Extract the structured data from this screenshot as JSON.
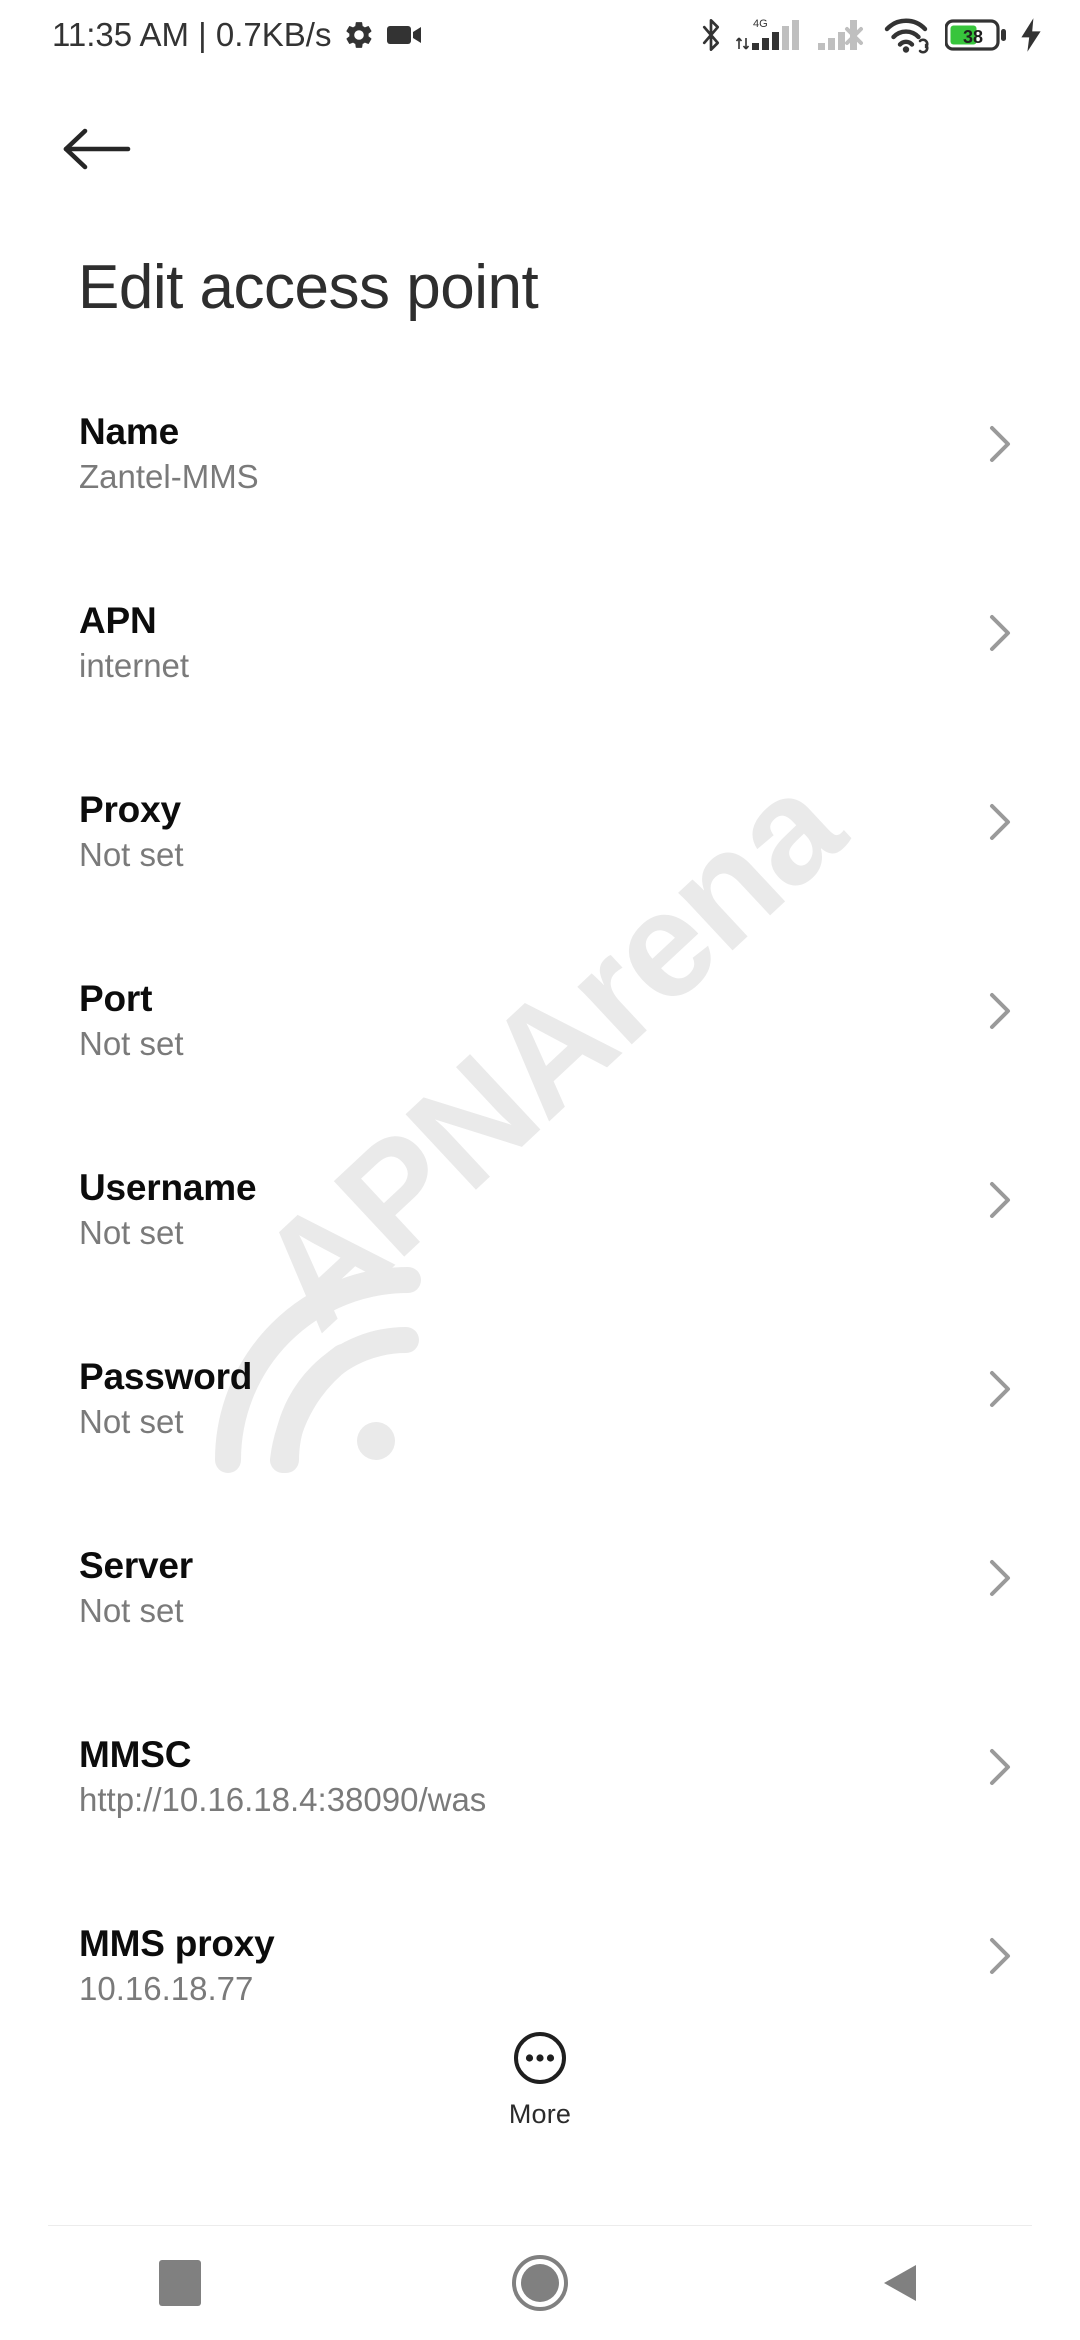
{
  "status_bar": {
    "clock": "11:35 AM | 0.7KB/s",
    "icons": [
      "gear-icon",
      "video-camera-icon",
      "bluetooth-icon",
      "signal-4g-icon",
      "signal-no-service-icon",
      "wifi-icon",
      "battery-icon",
      "charging-bolt-icon"
    ],
    "network_label": "4G",
    "battery_percent": "38",
    "battery_color": "#37c53c"
  },
  "header": {
    "back_icon": "arrow-left-icon",
    "title": "Edit access point"
  },
  "list": {
    "chevron_icon": "chevron-right-icon",
    "items": [
      {
        "label": "Name",
        "value": "Zantel-MMS"
      },
      {
        "label": "APN",
        "value": "internet"
      },
      {
        "label": "Proxy",
        "value": "Not set"
      },
      {
        "label": "Port",
        "value": "Not set"
      },
      {
        "label": "Username",
        "value": "Not set"
      },
      {
        "label": "Password",
        "value": "Not set"
      },
      {
        "label": "Server",
        "value": "Not set"
      },
      {
        "label": "MMSC",
        "value": "http://10.16.18.4:38090/was"
      },
      {
        "label": "MMS proxy",
        "value": "10.16.18.77"
      }
    ]
  },
  "more_button": {
    "label": "More",
    "icon": "more-circle-icon"
  },
  "nav_bar": {
    "recents_label": "Recents",
    "home_label": "Home",
    "back_label": "Back",
    "icon_color": "#808080"
  },
  "watermark": {
    "text": "APNArena",
    "logo": "wifi-arc-icon",
    "color": "#eaeaea"
  },
  "colors": {
    "background": "#ffffff",
    "title_text": "#2e2e2e",
    "row_title": "#0c0c0c",
    "row_value": "#7a7a7a",
    "chevron": "#9a9a9a",
    "divider": "#ececec"
  }
}
